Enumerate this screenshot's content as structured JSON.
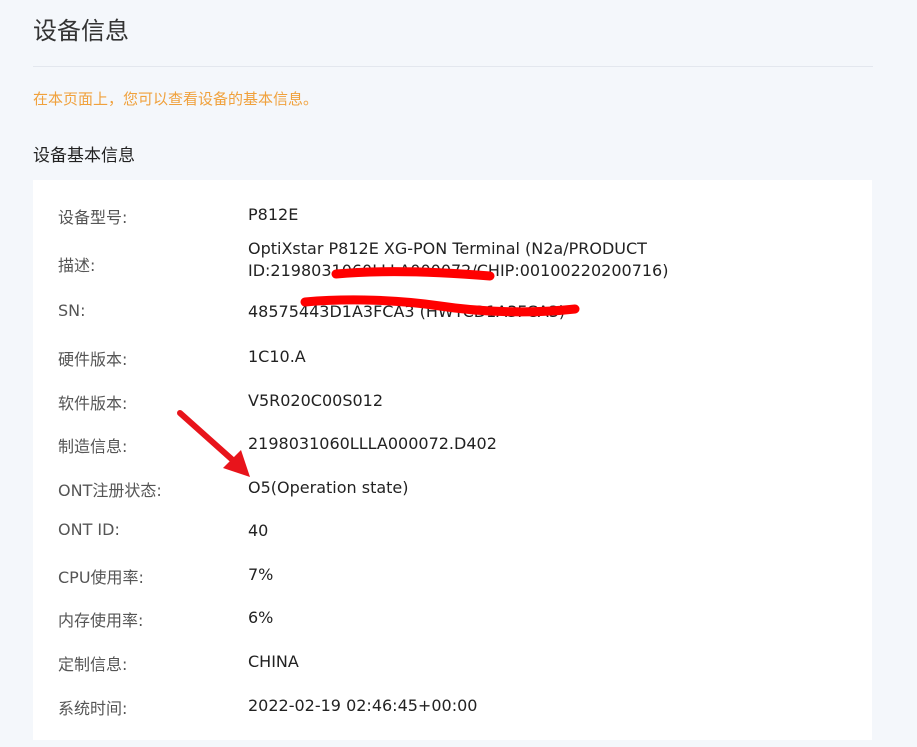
{
  "header": {
    "title": "设备信息",
    "hint": "在本页面上，您可以查看设备的基本信息。"
  },
  "section": {
    "title": "设备基本信息"
  },
  "rows": [
    {
      "label": "设备型号:",
      "value": "P812E"
    },
    {
      "label": "描述:",
      "value_line1": "OptiXstar P812E XG-PON Terminal (N2a/PRODUCT",
      "value_line2": "ID:21980310​60LLLA000072/CHIP:00100220200716)"
    },
    {
      "label": "SN:",
      "value": "4857544​3D1A3FCA3 (HWTC​D1A3FCA3)"
    },
    {
      "label": "硬件版本:",
      "value": "1C10.A"
    },
    {
      "label": "软件版本:",
      "value": "V5R020C00S012"
    },
    {
      "label": "制造信息:",
      "value": "2198031060LLLA000072.D402"
    },
    {
      "label": "ONT注册状态:",
      "value": "O5(Operation state)"
    },
    {
      "label": "ONT ID:",
      "value": "40"
    },
    {
      "label": "CPU使用率:",
      "value": "7%"
    },
    {
      "label": "内存使用率:",
      "value": "6%"
    },
    {
      "label": "定制信息:",
      "value": "CHINA"
    },
    {
      "label": "系统时间:",
      "value": "2022-02-19 02:46:45+00:00"
    }
  ],
  "annotations": {
    "redaction_color": "#ff0000",
    "arrow_color": "#e8141b"
  }
}
